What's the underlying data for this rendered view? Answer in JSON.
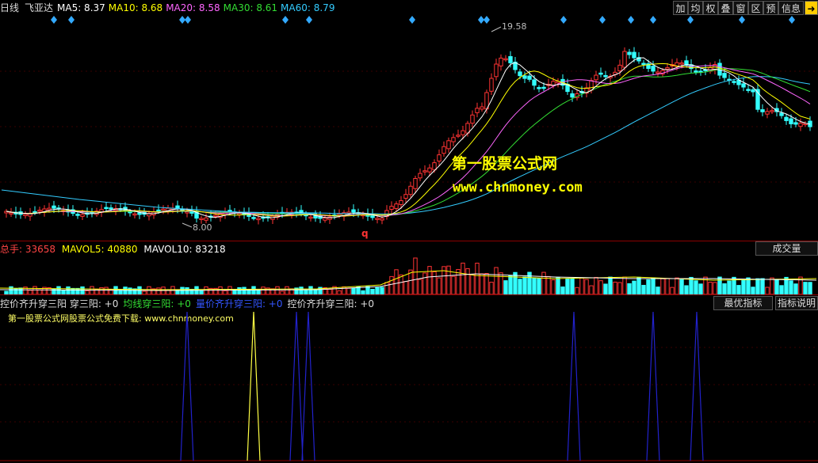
{
  "header": {
    "period": "日线",
    "stock_name": "飞亚达",
    "ma": [
      {
        "label": "MA5:",
        "value": "8.37",
        "color": "#ffffff"
      },
      {
        "label": "MA10:",
        "value": "8.68",
        "color": "#ffff00"
      },
      {
        "label": "MA20:",
        "value": "8.58",
        "color": "#ff66ff"
      },
      {
        "label": "MA30:",
        "value": "8.61",
        "color": "#33dd33"
      },
      {
        "label": "MA60:",
        "value": "8.79",
        "color": "#33ccff"
      }
    ],
    "buttons": [
      "加",
      "均",
      "权",
      "叠",
      "窗",
      "区",
      "预",
      "信息"
    ],
    "arrow_icon": "arrow-right-icon"
  },
  "price_chart": {
    "high_label": "19.58",
    "low_label": "8.00",
    "signal_marker": "q",
    "watermark_title": "第一股票公式网",
    "watermark_url": "www.chnmoney.com"
  },
  "volume_panel": {
    "total_label": "总手:",
    "total_value": "33658",
    "mavol5_label": "MAVOL5:",
    "mavol5_value": "40880",
    "mavol10_label": "MAVOL10:",
    "mavol10_value": "83218",
    "button": "成交量"
  },
  "indicator_panel": {
    "items": [
      {
        "text": "控价齐升穿三阳 穿三阳: +0",
        "color": "#dddddd"
      },
      {
        "text": "均线穿三阳: +0",
        "color": "#33dd33"
      },
      {
        "text": "量价齐升穿三阳: +0",
        "color": "#3355ff"
      },
      {
        "text": "控价齐升穿三阳: +0",
        "color": "#dddddd"
      }
    ],
    "note": "第一股票公式网股票公式免费下载: www.chnmoney.com",
    "buttons": [
      "最优指标",
      "指标说明"
    ]
  },
  "colors": {
    "up": "#ff3333",
    "down": "#33ffff",
    "ma5": "#ffffff",
    "ma10": "#ffff00",
    "ma20": "#ff66ff",
    "ma30": "#33dd33",
    "ma60": "#33ccff",
    "signal_blue": "#2222cc",
    "signal_yellow": "#ffff44"
  }
}
